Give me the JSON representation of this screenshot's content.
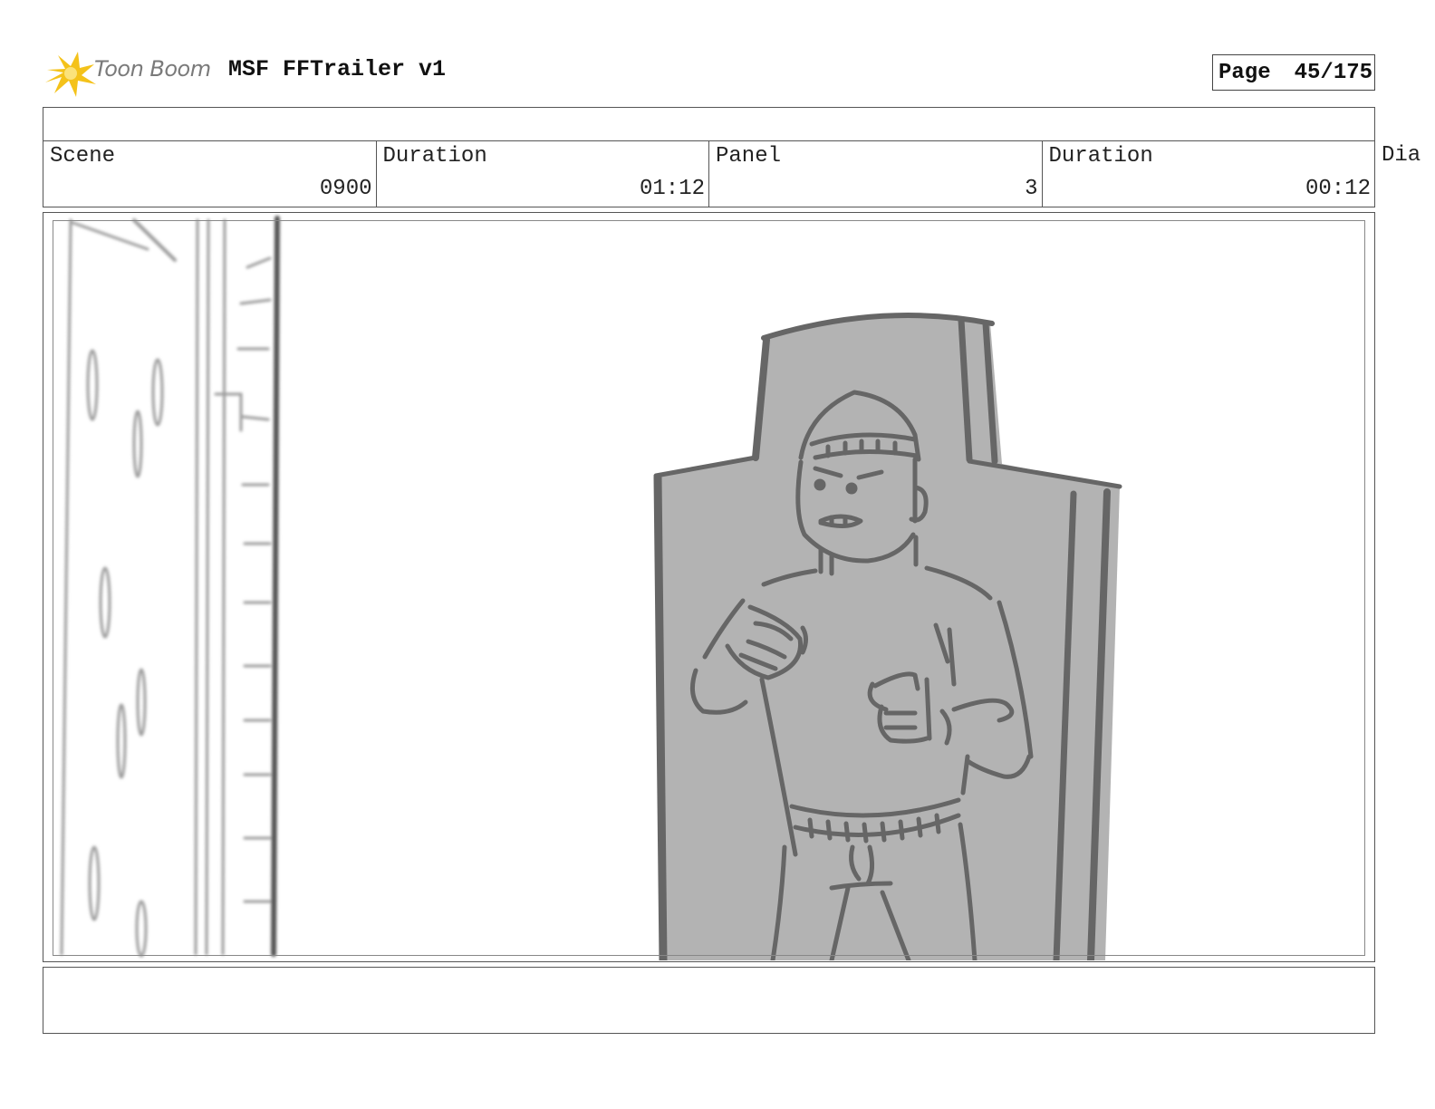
{
  "header": {
    "logo_text": "Toon Boom",
    "project_title": "MSF FFTrailer v1",
    "page_label": "Page",
    "page_value": "45/175"
  },
  "info": {
    "scene_label": "Scene",
    "scene_value": "0900",
    "scene_duration_label": "Duration",
    "scene_duration_value": "01:12",
    "panel_label": "Panel",
    "panel_value": "3",
    "panel_duration_label": "Duration",
    "panel_duration_value": "00:12",
    "dialog_label_cut": "Dia"
  },
  "colors": {
    "logo_star": "#f4c21a",
    "sketch_line": "#666666",
    "sketch_fill": "#b3b3b3"
  }
}
